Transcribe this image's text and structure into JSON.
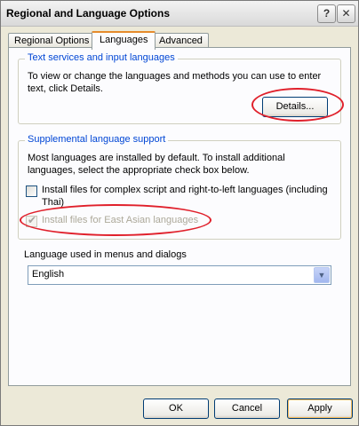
{
  "window": {
    "title": "Regional and Language Options",
    "help_glyph": "?",
    "close_glyph": "✕"
  },
  "tabs": [
    {
      "label": "Regional Options",
      "active": false
    },
    {
      "label": "Languages",
      "active": true
    },
    {
      "label": "Advanced",
      "active": false
    }
  ],
  "text_services": {
    "legend": "Text services and input languages",
    "description": "To view or change the languages and methods you can use to enter text, click Details.",
    "details_button": "Details..."
  },
  "supplemental": {
    "legend": "Supplemental language support",
    "description": "Most languages are installed by default. To install additional languages, select the appropriate check box below.",
    "complex_script": {
      "label": "Install files for complex script and right-to-left languages (including Thai)",
      "checked": false,
      "enabled": true
    },
    "east_asian": {
      "label": "Install files for East Asian languages",
      "checked": true,
      "enabled": false
    }
  },
  "menus_language": {
    "label": "Language used in menus and dialogs",
    "value": "English",
    "arrow_glyph": "▼"
  },
  "footer": {
    "ok": "OK",
    "cancel": "Cancel",
    "apply": "Apply"
  },
  "annotation_color": "#e0202b"
}
